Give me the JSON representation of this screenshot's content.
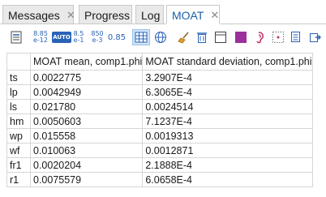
{
  "tabs": [
    {
      "label": "Messages",
      "closable": true,
      "active": false
    },
    {
      "label": "Progress",
      "closable": false,
      "active": false
    },
    {
      "label": "Log",
      "closable": false,
      "active": false
    },
    {
      "label": "MOAT",
      "closable": true,
      "active": true
    }
  ],
  "close_glyph": "✕",
  "toolbar": {
    "format_buttons": [
      {
        "top": "8.85",
        "bottom": "e-12"
      },
      {
        "top": "8.5",
        "bottom": "e-1"
      },
      {
        "top": "850",
        "bottom": "e-3"
      }
    ],
    "auto_label": "AUTO",
    "precision_label": "0.85",
    "accent": "#2a62b8"
  },
  "table": {
    "columns": [
      "",
      "MOAT mean, comp1.phi",
      "MOAT standard deviation, comp1.phi"
    ],
    "rows": [
      [
        "ts",
        "0.0022775",
        "3.2907E-4"
      ],
      [
        "lp",
        "0.0042949",
        "6.3065E-4"
      ],
      [
        "ls",
        "0.021780",
        "0.0024514"
      ],
      [
        "hm",
        "0.0050603",
        "7.1237E-4"
      ],
      [
        "wp",
        "0.015558",
        "0.0019313"
      ],
      [
        "wf",
        "0.010063",
        "0.0012871"
      ],
      [
        "fr1",
        "0.0020204",
        "2.1888E-4"
      ],
      [
        "r1",
        "0.0075579",
        "6.0658E-4"
      ]
    ]
  }
}
